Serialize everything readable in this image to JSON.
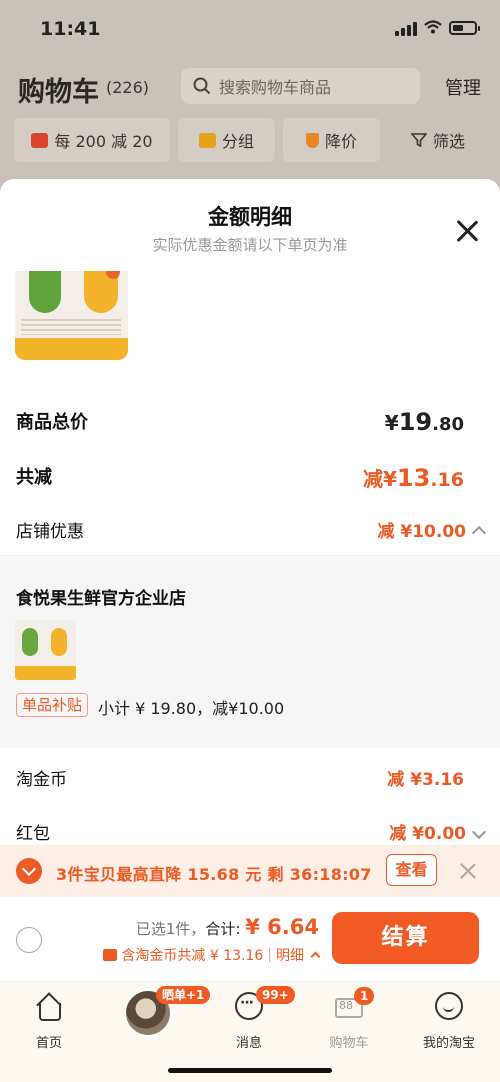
{
  "status_bar": {
    "time": "11:41"
  },
  "cart_header": {
    "title": "购物车",
    "count": "(226)",
    "search_placeholder": "搜索购物车商品",
    "manage_label": "管理"
  },
  "filters": [
    {
      "label": "每 200 减 20",
      "icon": "shop-icon",
      "color": "#d9442f"
    },
    {
      "label": "分组",
      "icon": "folder-icon",
      "color": "#e6a21b"
    },
    {
      "label": "降价",
      "icon": "price-down-icon",
      "color": "#e8872a"
    },
    {
      "label": "筛选",
      "icon": "filter-icon",
      "color": "#555555"
    }
  ],
  "sheet": {
    "title": "金额明细",
    "subtitle": "实际优惠金额请以下单页为准",
    "rows": {
      "total_price": {
        "label": "商品总价",
        "currency": "¥",
        "int": "19",
        "dec": ".80"
      },
      "total_discount": {
        "label": "共减",
        "prefix": "减",
        "currency": "¥",
        "int": "13",
        "dec": ".16"
      },
      "store_discount": {
        "label": "店铺优惠",
        "value": "减 ¥10.00"
      },
      "tao_coins": {
        "label": "淘金币",
        "value": "减 ¥3.16"
      },
      "red_packet": {
        "label": "红包",
        "value": "减 ¥0.00"
      }
    },
    "shop": {
      "name": "食悦果生鲜官方企业店",
      "tag": "单品补贴",
      "subsidy_text": "小计 ¥ 19.80，减¥10.00"
    }
  },
  "promo_bar": {
    "text": "3件宝贝最高直降 15.68 元 剩 36:18:07",
    "button_label": "查看"
  },
  "checkout": {
    "selected": "已选1件，",
    "total_label": "合计:",
    "total_value": "¥ 6.64",
    "coin_text": "含淘金币共减 ¥ 13.16",
    "separator": "|",
    "detail_label": "明细",
    "pay_label": "结算"
  },
  "tabbar": {
    "home": "首页",
    "avatar_badge": "晒单+1",
    "messages": "消息",
    "messages_badge": "99+",
    "cart": "购物车",
    "cart_badge": "1",
    "cart_icon_num": "88",
    "mine": "我的淘宝"
  },
  "colors": {
    "accent": "#ec5b25",
    "pay_button": "#f15b23",
    "promo_bg": "#fdeee6"
  }
}
